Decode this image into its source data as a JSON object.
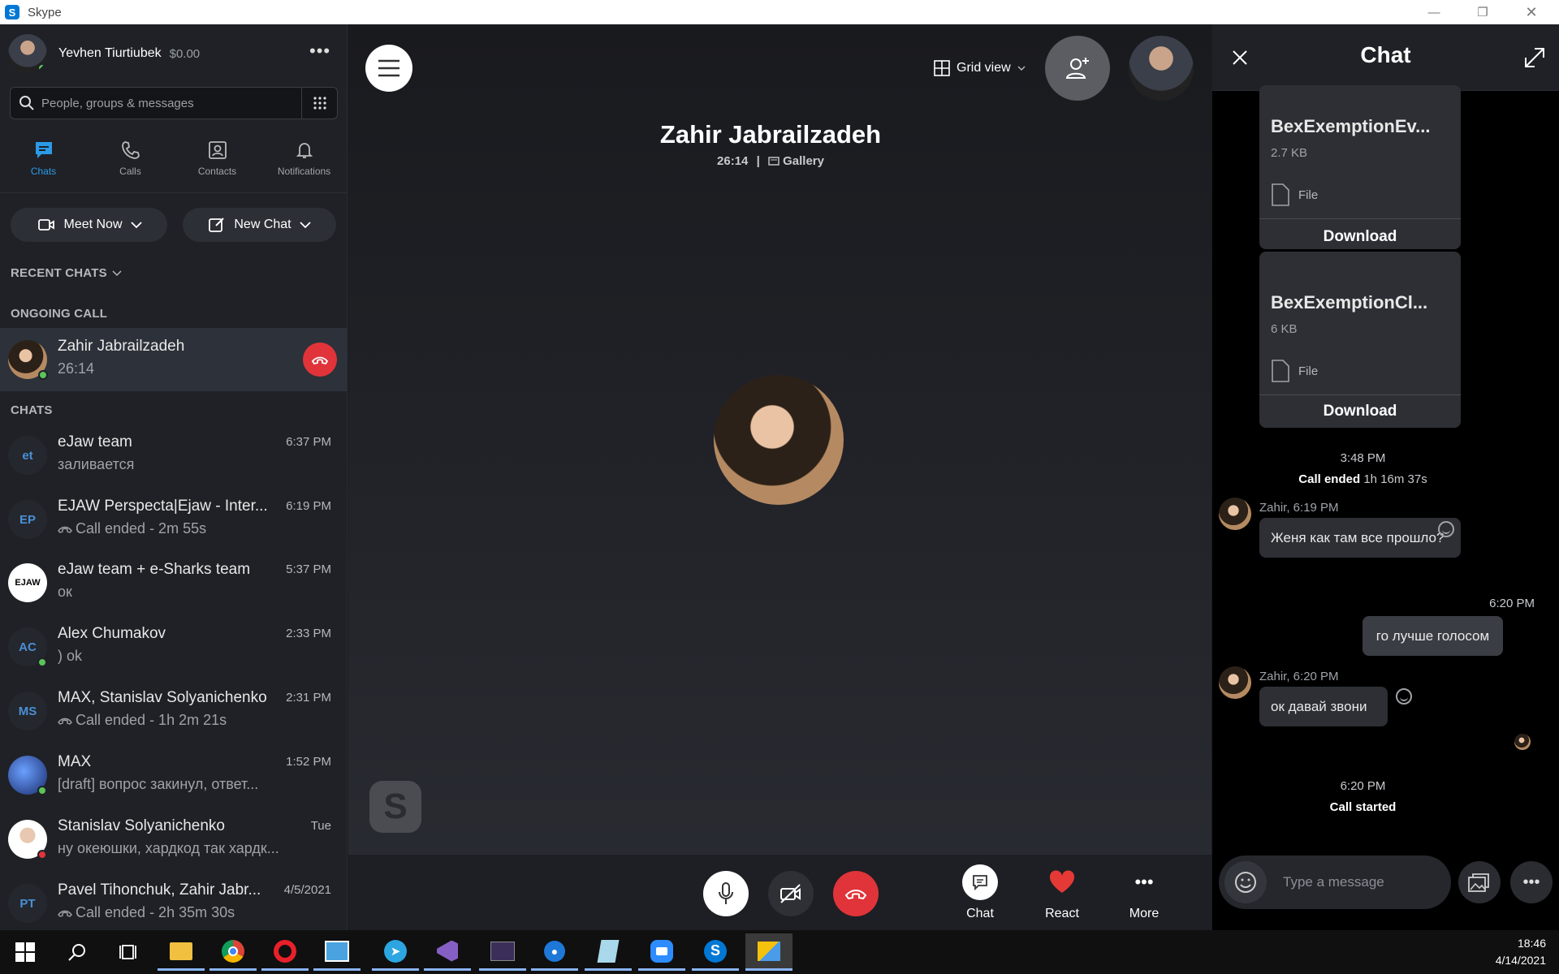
{
  "window": {
    "title": "Skype"
  },
  "profile": {
    "name": "Yevhen Tiurtiubek",
    "balance": "$0.00"
  },
  "search": {
    "placeholder": "People, groups & messages"
  },
  "nav": [
    {
      "label": "Chats",
      "icon": "chat-icon"
    },
    {
      "label": "Calls",
      "icon": "phone-icon"
    },
    {
      "label": "Contacts",
      "icon": "contacts-icon"
    },
    {
      "label": "Notifications",
      "icon": "bell-icon"
    }
  ],
  "buttons": {
    "meet_now": "Meet Now",
    "new_chat": "New Chat"
  },
  "sections": {
    "recent": "RECENT CHATS",
    "ongoing": "ONGOING CALL",
    "chats": "CHATS"
  },
  "ongoing_call": {
    "name": "Zahir Jabrailzadeh",
    "duration": "26:14"
  },
  "chats": [
    {
      "initials": "et",
      "name": "eJaw team",
      "message": "заливается",
      "time": "6:37 PM",
      "call": false
    },
    {
      "initials": "EP",
      "name": "EJAW Perspecta|Ejaw - Inter...",
      "message": "Call ended - 2m 55s",
      "time": "6:19 PM",
      "call": true
    },
    {
      "initials": "EJAW",
      "name": "eJaw team + e-Sharks team",
      "message": "ок",
      "time": "5:37 PM",
      "call": false
    },
    {
      "initials": "AC",
      "name": "Alex Chumakov",
      "message": ") ok",
      "time": "2:33 PM",
      "call": false
    },
    {
      "initials": "MS",
      "name": "MAX, Stanislav Solyanichenko",
      "message": "Call ended - 1h 2m 21s",
      "time": "2:31 PM",
      "call": true
    },
    {
      "initials": "",
      "name": "MAX",
      "message": "[draft] вопрос закинул, ответ...",
      "time": "1:52 PM",
      "call": false
    },
    {
      "initials": "",
      "name": "Stanislav Solyanichenko",
      "message": "ну океюшки, хардкод так хардк...",
      "time": "Tue",
      "call": false
    },
    {
      "initials": "PT",
      "name": "Pavel Tihonchuk, Zahir Jabr...",
      "message": "Call ended - 2h 35m 30s",
      "time": "4/5/2021",
      "call": true
    }
  ],
  "call": {
    "grid_view": "Grid view",
    "contact_name": "Zahir Jabrailzadeh",
    "duration": "26:14",
    "separator": "|",
    "mode": "Gallery",
    "actions": {
      "chat": "Chat",
      "react": "React",
      "more": "More"
    }
  },
  "chat_panel": {
    "title": "Chat",
    "files": [
      {
        "name": "BexExemptionEv...",
        "size": "2.7 KB",
        "type": "File",
        "action": "Download"
      },
      {
        "name": "BexExemptionCl...",
        "size": "6 KB",
        "type": "File",
        "action": "Download"
      }
    ],
    "call_ended": {
      "time": "3:48 PM",
      "label": "Call ended",
      "duration": "1h 16m 37s"
    },
    "messages": [
      {
        "sender": "Zahir, 6:19 PM",
        "text": "Женя как там все прошло?"
      },
      {
        "time": "6:20 PM",
        "text": "го лучше голосом"
      },
      {
        "sender": "Zahir, 6:20 PM",
        "text": "ок давай звони"
      }
    ],
    "call_started": {
      "time": "6:20 PM",
      "label": "Call started"
    },
    "composer_placeholder": "Type a message"
  },
  "taskbar": {
    "time": "18:46",
    "date": "4/14/2021"
  },
  "colors": {
    "accent": "#2b9be8",
    "end_call": "#e0343a",
    "online": "#5ac45a",
    "react": "#e53935"
  }
}
